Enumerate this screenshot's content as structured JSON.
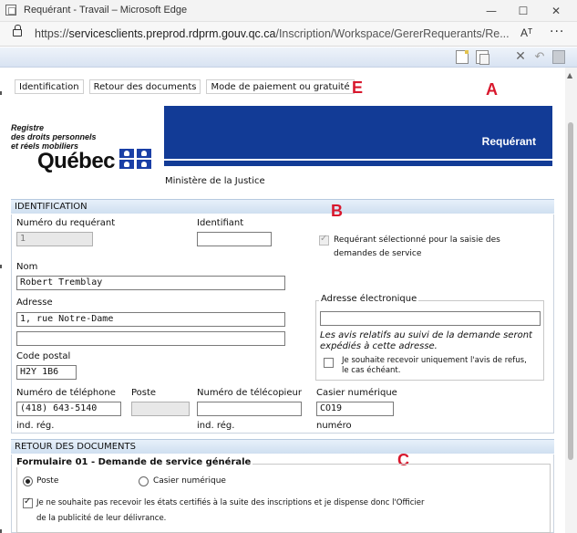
{
  "window": {
    "title": "Requérant - Travail – Microsoft Edge",
    "minimize": "—",
    "maximize": "☐",
    "close": "✕"
  },
  "address": {
    "scheme": "https://",
    "host": "servicesclients.preprod.rdprm.gouv.qc.ca",
    "path": "/Inscription/Workspace/GererRequerants/Re...",
    "read_aloud": "Aᵀ",
    "more": "···"
  },
  "toolbar": {
    "icons": [
      "new-document-icon",
      "copy-icon",
      "close-icon",
      "undo-icon",
      "save-icon"
    ]
  },
  "tabs": [
    "Identification",
    "Retour des documents",
    "Mode de paiement ou gratuité"
  ],
  "annotations": {
    "a": "A",
    "b": "B",
    "c": "C",
    "e": "E"
  },
  "header": {
    "logo_line1": "Registre",
    "logo_line2": "des droits personnels",
    "logo_line3": "et réels mobiliers",
    "logo_word": "Québec",
    "banner_title": "Requérant",
    "ministry": "Ministère de la Justice",
    "colors": {
      "banner": "#123b96",
      "accent": "#d8182d"
    }
  },
  "identification": {
    "section_title": "IDENTIFICATION",
    "numero_label": "Numéro du requérant",
    "numero_value": "1",
    "identifiant_label": "Identifiant",
    "identifiant_value": "",
    "selected_label_1": "Requérant sélectionné pour la saisie des",
    "selected_label_2": "demandes de service",
    "nom_label": "Nom",
    "nom_value": "Robert Tremblay",
    "adresse_label": "Adresse",
    "adresse_line1": "1, rue Notre-Dame",
    "adresse_line2": "",
    "code_postal_label": "Code postal",
    "code_postal_value": "H2Y 1B6",
    "email_legend": "Adresse électronique",
    "email_value": "",
    "email_note_1": "Les avis relatifs au suivi de la demande seront",
    "email_note_2": "expédiés à cette adresse.",
    "refus_label_1": "Je souhaite recevoir uniquement l'avis de refus,",
    "refus_label_2": "le cas échéant.",
    "tel_label": "Numéro de téléphone",
    "tel_value": "(418) 643-5140",
    "tel_hint": "ind. rég.",
    "poste_label": "Poste",
    "poste_value": "",
    "fax_label": "Numéro de télécopieur",
    "fax_value": "",
    "fax_hint": "ind. rég.",
    "casier_label": "Casier numérique",
    "casier_value": "CO19",
    "casier_hint": "numéro"
  },
  "retour": {
    "section_title": "RETOUR DES DOCUMENTS",
    "form_title": "Formulaire 01 - Demande de service générale",
    "option_poste": "Poste",
    "option_casier": "Casier numérique",
    "selected": "Poste",
    "waiver_1": "Je ne souhaite pas recevoir les états certifiés à la suite des inscriptions et je dispense donc l'Officier",
    "waiver_2": "de la publicité de leur délivrance."
  }
}
